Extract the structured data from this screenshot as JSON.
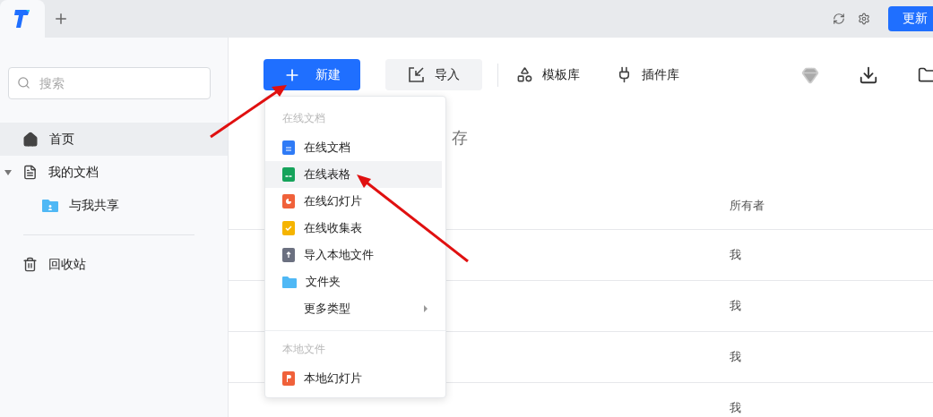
{
  "top_bar": {
    "update_button": "更新"
  },
  "sidebar": {
    "search": {
      "placeholder": "搜索"
    },
    "items": [
      {
        "label": "首页",
        "kind": "home",
        "selected": true
      },
      {
        "label": "我的文档",
        "kind": "doc",
        "selected": false,
        "expanded": true,
        "children": [
          {
            "label": "与我共享",
            "kind": "shared",
            "selected": false
          }
        ]
      }
    ],
    "bottom_items": [
      {
        "label": "回收站",
        "kind": "trash",
        "selected": false
      }
    ]
  },
  "toolbar": {
    "new_button": "新建",
    "import_button": "导入",
    "links": [
      {
        "label": "模板库",
        "kind": "templates"
      },
      {
        "label": "插件库",
        "kind": "plugins"
      }
    ]
  },
  "content": {
    "section_title": "存",
    "table": {
      "columns": [
        {
          "label": "所有者"
        }
      ],
      "rows": [
        {
          "owner": "我"
        },
        {
          "owner": "我"
        },
        {
          "owner": "我"
        },
        {
          "owner": "我"
        }
      ]
    }
  },
  "new_menu": {
    "sections": [
      {
        "title": "在线文档",
        "items": [
          {
            "label": "在线文档",
            "kind": "doc",
            "selected": false
          },
          {
            "label": "在线表格",
            "kind": "sheet",
            "selected": true
          },
          {
            "label": "在线幻灯片",
            "kind": "slides",
            "selected": false
          },
          {
            "label": "在线收集表",
            "kind": "form",
            "selected": false
          },
          {
            "label": "导入本地文件",
            "kind": "upload",
            "selected": false
          },
          {
            "label": "文件夹",
            "kind": "folder",
            "selected": false
          },
          {
            "label": "更多类型",
            "kind": "more",
            "selected": false,
            "has_submenu": true
          }
        ]
      },
      {
        "title": "本地文件",
        "items": [
          {
            "label": "本地幻灯片",
            "kind": "ppt",
            "selected": false
          }
        ]
      }
    ]
  }
}
